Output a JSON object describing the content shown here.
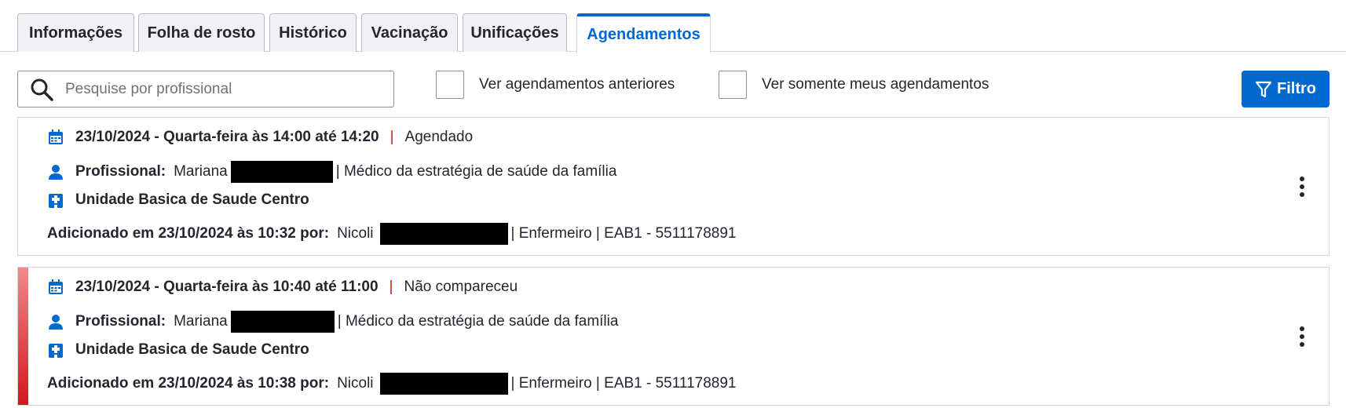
{
  "tabs": [
    {
      "label": "Informações"
    },
    {
      "label": "Folha de rosto"
    },
    {
      "label": "Histórico"
    },
    {
      "label": "Vacinação"
    },
    {
      "label": "Unificações"
    },
    {
      "label": "Agendamentos",
      "active": true
    }
  ],
  "search": {
    "placeholder": "Pesquise por profissional",
    "value": ""
  },
  "filters": {
    "past_label": "Ver agendamentos anteriores",
    "mine_label": "Ver somente meus agendamentos",
    "past_checked": false,
    "mine_checked": false
  },
  "filter_button": {
    "label": "Filtro"
  },
  "appointments": [
    {
      "datetime": "23/10/2024 - Quarta-feira às 14:00 até 14:20",
      "status": "Agendado",
      "professional_label": "Profissional:",
      "professional_name": "Mariana",
      "professional_role": "| Médico da estratégia de saúde da família",
      "unit": "Unidade Basica de Saude Centro",
      "added_label": "Adicionado em 23/10/2024 às 10:32 por:",
      "added_by": "Nicoli",
      "added_details": "| Enfermeiro | EAB1 - 5511178891"
    },
    {
      "datetime": "23/10/2024 - Quarta-feira às 10:40 até 11:00",
      "status": "Não compareceu",
      "professional_label": "Profissional:",
      "professional_name": "Mariana",
      "professional_role": "| Médico da estratégia de saúde da família",
      "unit": "Unidade Basica de Saude Centro",
      "added_label": "Adicionado em 23/10/2024 às 10:38 por:",
      "added_by": "Nicoli",
      "added_details": "| Enfermeiro | EAB1 - 5511178891"
    }
  ],
  "colors": {
    "accent": "#0069d0",
    "missed": "#d3161f",
    "separator": "#d3161f"
  }
}
